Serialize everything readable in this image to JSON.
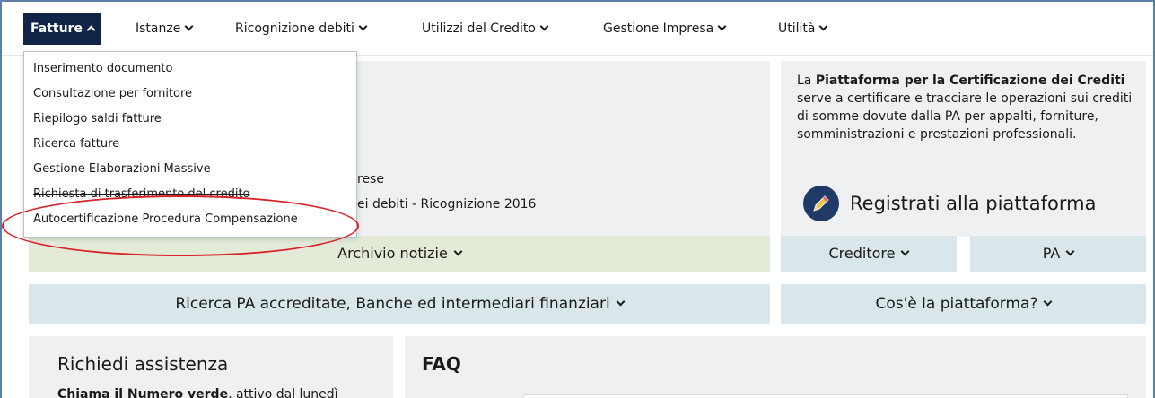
{
  "nav": {
    "items": [
      {
        "label": "Fatture"
      },
      {
        "label": "Istanze"
      },
      {
        "label": "Ricognizione debiti"
      },
      {
        "label": "Utilizzi del Credito"
      },
      {
        "label": "Gestione Impresa"
      },
      {
        "label": "Utilità"
      }
    ]
  },
  "dropdown": {
    "items": [
      {
        "label": "Inserimento documento"
      },
      {
        "label": "Consultazione per fornitore"
      },
      {
        "label": "Riepilogo saldi fatture"
      },
      {
        "label": "Ricerca fatture"
      },
      {
        "label": "Gestione Elaborazioni Massive"
      },
      {
        "label": "Richiesta di trasferimento del credito"
      },
      {
        "label": "Autocertificazione Procedura Compensazione"
      }
    ]
  },
  "news": {
    "partial_line_1": "rese",
    "partial_line_2": "ei debiti - Ricognizione 2016",
    "archive_label": "Archivio notizie"
  },
  "info": {
    "text_bold_1": "Piattaforma per la Certificazione dei Crediti",
    "text_prefix": "La ",
    "text_rest": " serve a certificare e tracciare le operazioni sui crediti di somme dovute dalla PA per appalti, forniture, somministrazioni e prestazioni professionali.",
    "register_label": "Registrati alla piattaforma",
    "creditore_label": "Creditore",
    "pa_label": "PA"
  },
  "search_bar": {
    "label": "Ricerca PA accreditate, Banche ed intermediari finanziari"
  },
  "about_bar": {
    "label": "Cos'è la piattaforma?"
  },
  "assistance": {
    "title": "Richiedi assistenza",
    "text_bold": "Chiama il Numero verde",
    "text_rest": ", attivo dal lunedì"
  },
  "faq": {
    "title": "FAQ"
  },
  "colors": {
    "nav_active": "#0f2446",
    "highlight_oval": "#d8232a",
    "green_bar": "#e3ead8",
    "teal_bar": "#d9e7ea"
  }
}
